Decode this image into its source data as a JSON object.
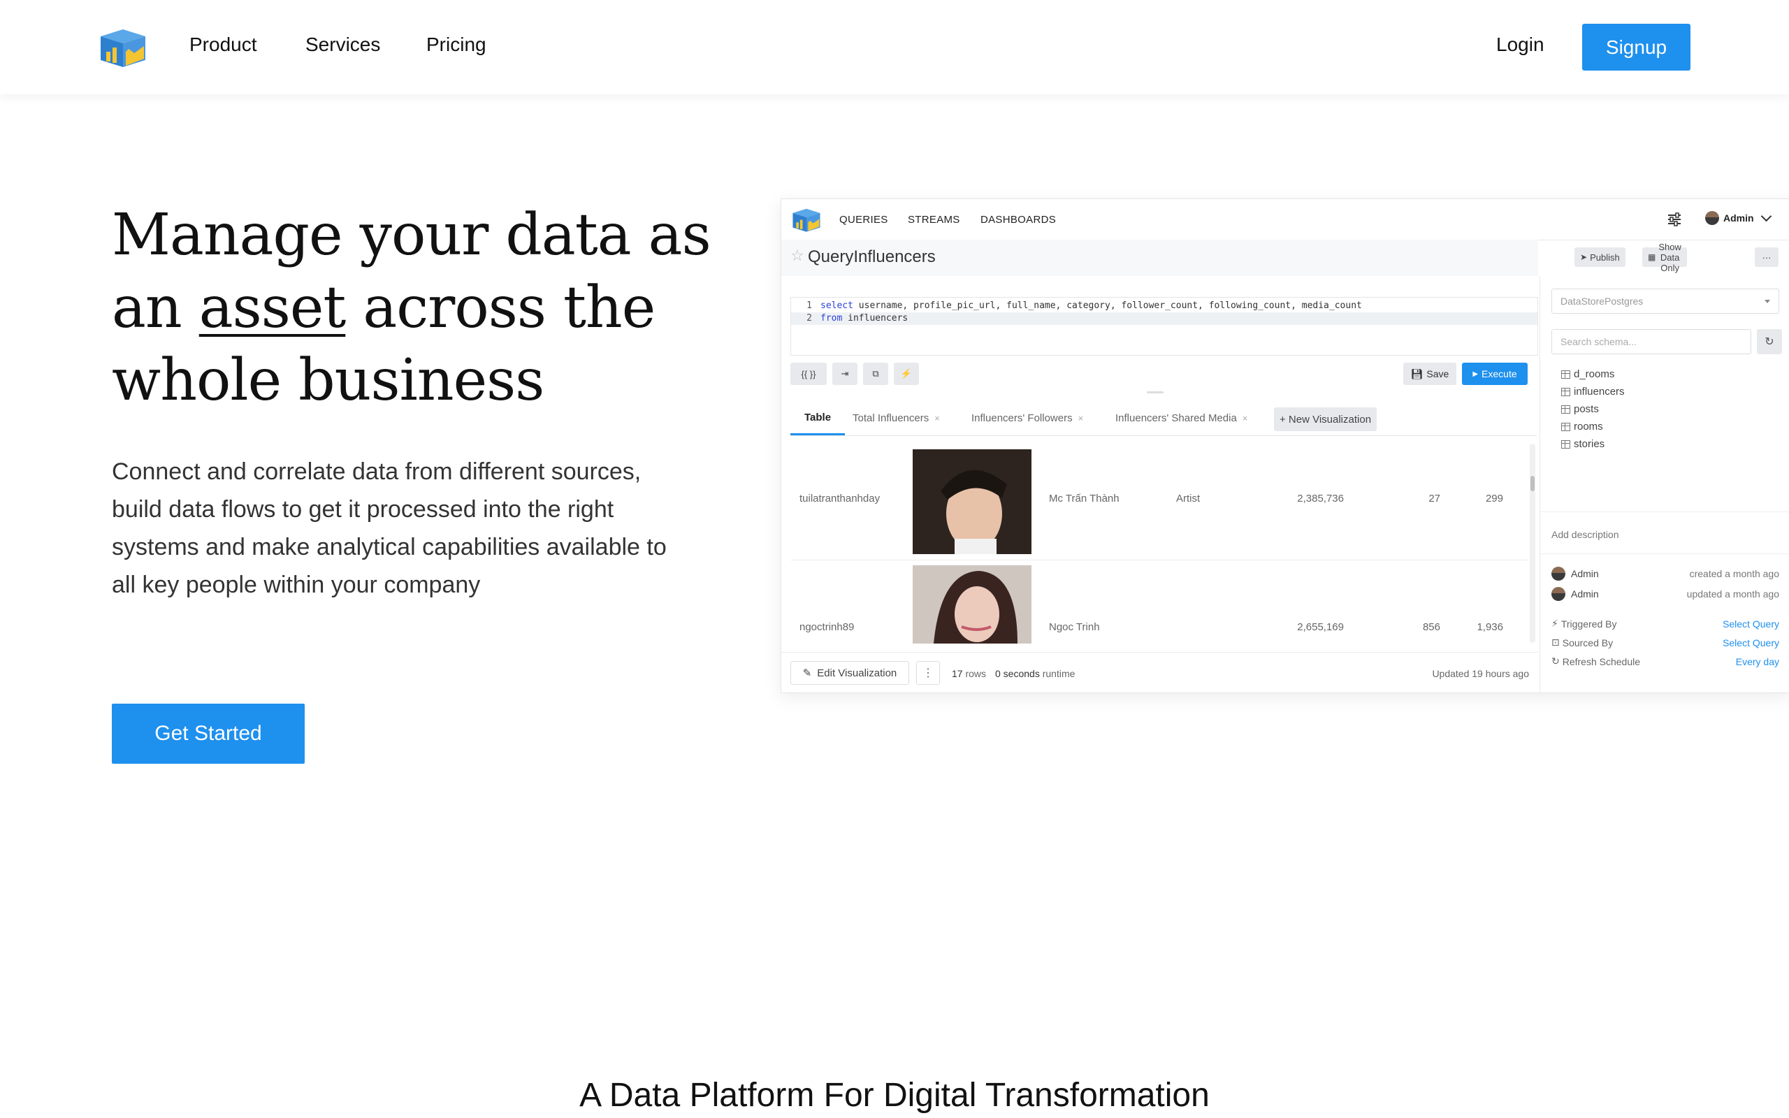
{
  "nav": {
    "links": [
      "Product",
      "Services",
      "Pricing"
    ],
    "login": "Login",
    "signup": "Signup"
  },
  "hero": {
    "title_pre": "Manage your data as an ",
    "title_underlined": "asset",
    "title_post": " across the whole business",
    "text": "Connect and correlate data from different sources, build data flows to get it processed into the right systems and make analytical capabilities available to all key people within your company",
    "cta": "Get Started"
  },
  "section_title": "A Data Platform For Digital Transformation",
  "app": {
    "nav": [
      "QUERIES",
      "STREAMS",
      "DASHBOARDS"
    ],
    "user": "Admin",
    "query_title": "QueryInfluencers",
    "header_buttons": {
      "publish": "Publish",
      "show_data": "Show Data Only",
      "more": "···"
    },
    "code": {
      "line1_no": "1",
      "line1_kw": "select",
      "line1_rest": " username, profile_pic_url, full_name, category, follower_count, following_count, media_count",
      "line2_no": "2",
      "line2_kw": "from",
      "line2_rest": " influencers"
    },
    "tools": [
      "{{ }}",
      "⇥",
      "⧉",
      "⚡"
    ],
    "save": "Save",
    "execute": "Execute",
    "tabs": {
      "table": "Table",
      "items": [
        "Total Influencers",
        "Influencers' Followers",
        "Influencers' Shared Media"
      ],
      "close": "×",
      "new_viz": "+ New Visualization"
    },
    "rows": [
      {
        "username": "tuilatranthanhday",
        "full_name": "Mc Trấn Thành",
        "category": "Artist",
        "followers": "2,385,736",
        "following": "27",
        "media": "299"
      },
      {
        "username": "ngoctrinh89",
        "full_name": "Ngoc Trinh",
        "category": "",
        "followers": "2,655,169",
        "following": "856",
        "media": "1,936"
      }
    ],
    "footer": {
      "edit_viz": "Edit Visualization",
      "kebab": "⋮",
      "rows_count": "17",
      "rows_label": "rows",
      "runtime_value": "0 seconds",
      "runtime_label": "runtime",
      "updated": "Updated 19 hours ago"
    },
    "side": {
      "datasource": "DataStorePostgres",
      "search_placeholder": "Search schema...",
      "tables": [
        "d_rooms",
        "influencers",
        "posts",
        "rooms",
        "stories"
      ],
      "add_description": "Add description",
      "activity": [
        {
          "user": "Admin",
          "text": "created a month ago"
        },
        {
          "user": "Admin",
          "text": "updated a month ago"
        }
      ],
      "props": [
        {
          "icon": "⚡",
          "label": "Triggered By",
          "value": "Select Query"
        },
        {
          "icon": "⊡",
          "label": "Sourced By",
          "value": "Select Query"
        },
        {
          "icon": "↻",
          "label": "Refresh Schedule",
          "value": "Every day"
        }
      ]
    }
  },
  "colors": {
    "accent": "#1e90ee",
    "logo_blue": "#3d8fd6",
    "logo_yellow": "#f4c531"
  }
}
